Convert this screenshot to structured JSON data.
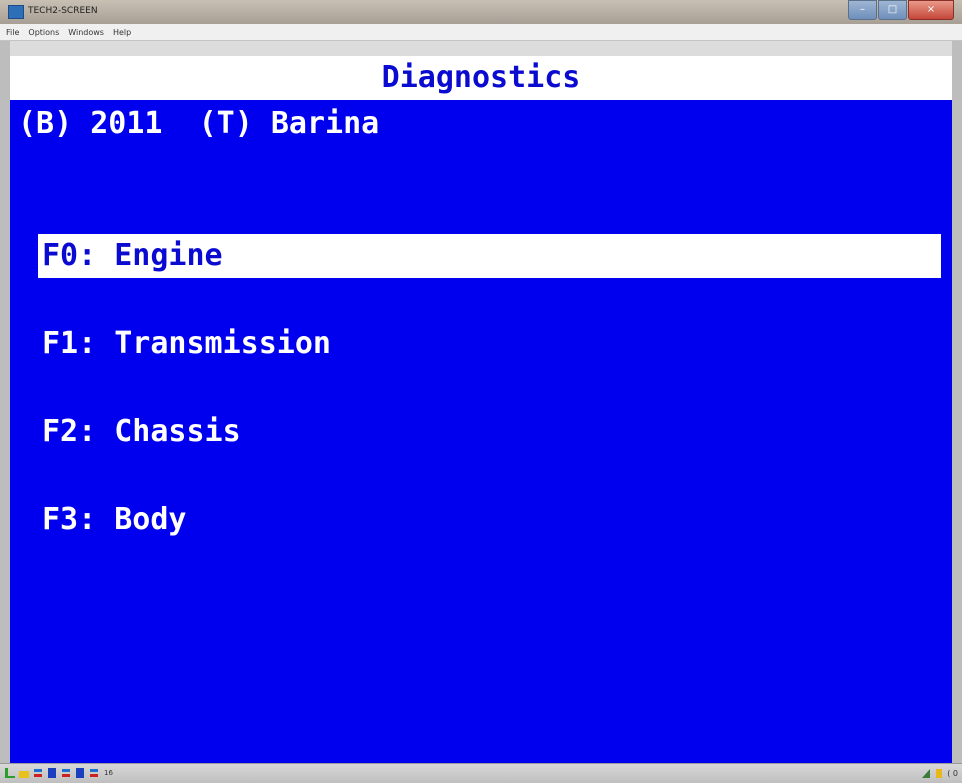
{
  "window": {
    "title": "TECH2-SCREEN",
    "controls": {
      "minimize": "–",
      "maximize": "□",
      "close": "×"
    }
  },
  "menubar": {
    "items": [
      "File",
      "Options",
      "Windows",
      "Help"
    ]
  },
  "screen": {
    "title": "Diagnostics",
    "vehicle_line": "(B) 2011  (T) Barina",
    "menu": [
      {
        "label": "F0: Engine",
        "selected": true
      },
      {
        "label": "F1: Transmission",
        "selected": false
      },
      {
        "label": "F2: Chassis",
        "selected": false
      },
      {
        "label": "F3: Body",
        "selected": false
      }
    ]
  },
  "taskbar": {
    "icons": [
      "status-green-icon",
      "bar-yellow-icon",
      "plug-icon",
      "chip-blue-icon",
      "plug-icon",
      "chip-blue-icon",
      "plug-icon"
    ],
    "label": "16",
    "tray_text": "( 0"
  },
  "colors": {
    "screen_bg": "#0000ee",
    "screen_text": "#ffffff",
    "title_text": "#0a0ad0",
    "highlight_bg": "#ffffff"
  }
}
